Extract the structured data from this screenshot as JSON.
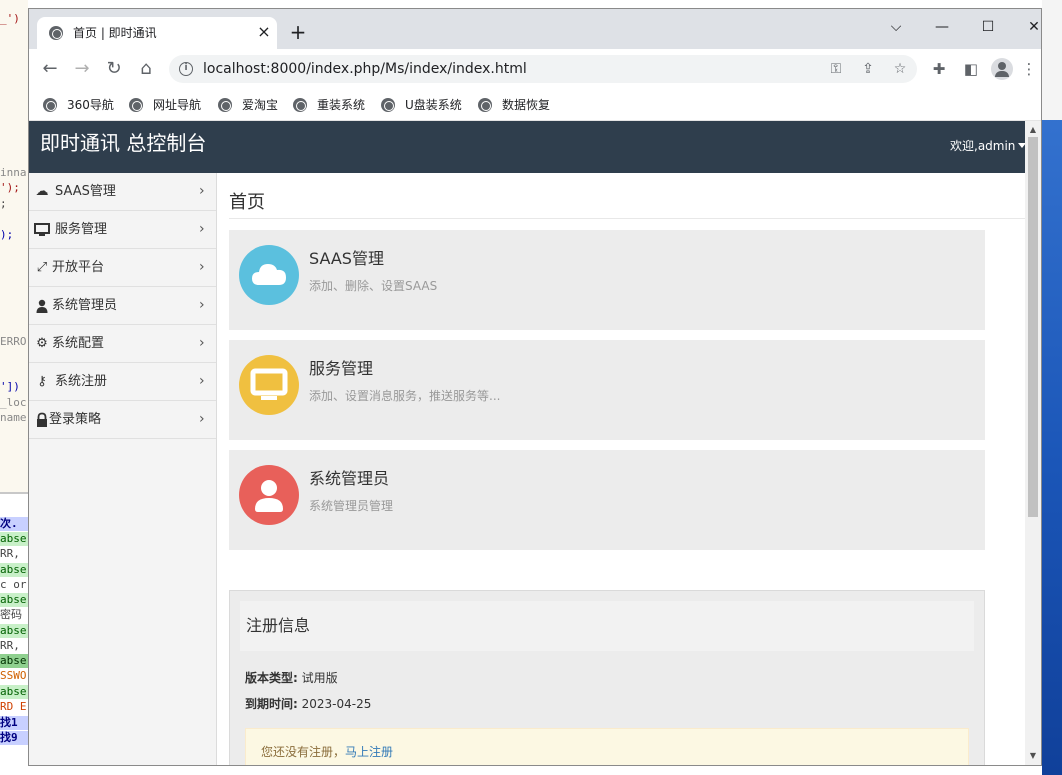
{
  "background": {
    "editor_lines": [
      "_')",
      "inna",
      "');",
      ";",
      ");",
      "ERRO",
      "'])",
      "_loc",
      "name"
    ],
    "log_lines": [
      "次.",
      "abse",
      "RR,",
      "abse",
      "c or",
      "abse",
      "密码",
      "abse",
      "RR,",
      "abse",
      "SSWO",
      "abse",
      "RD E",
      "找1",
      "找9"
    ]
  },
  "browser": {
    "tab_title": "首页 | 即时通讯",
    "tab_close": "×",
    "new_tab": "+",
    "url": "localhost:8000/index.php/Ms/index/index.html",
    "bookmarks": [
      "360导航",
      "网址导航",
      "爱淘宝",
      "重装系统",
      "U盘装系统",
      "数据恢复"
    ]
  },
  "app": {
    "title": "即时通讯 总控制台",
    "welcome": "欢迎,admin"
  },
  "sidebar": {
    "items": [
      {
        "label": "SAAS管理",
        "icon": "cloud-icon"
      },
      {
        "label": "服务管理",
        "icon": "monitor-icon"
      },
      {
        "label": "开放平台",
        "icon": "expand-icon"
      },
      {
        "label": "系统管理员",
        "icon": "user-icon"
      },
      {
        "label": "系统配置",
        "icon": "gear-icon"
      },
      {
        "label": "系统注册",
        "icon": "key-icon"
      },
      {
        "label": "登录策略",
        "icon": "lock-icon"
      }
    ]
  },
  "main": {
    "heading": "首页",
    "cards": [
      {
        "title": "SAAS管理",
        "desc": "添加、删除、设置SAAS",
        "icon": "cloud-icon",
        "color": "#5bc0de"
      },
      {
        "title": "服务管理",
        "desc": "添加、设置消息服务，推送服务等...",
        "icon": "monitor-icon",
        "color": "#f0c040"
      },
      {
        "title": "系统管理员",
        "desc": "系统管理员管理",
        "icon": "user-icon",
        "color": "#e8605a"
      }
    ],
    "registration": {
      "title": "注册信息",
      "version_label": "版本类型:",
      "version_value": "试用版",
      "expiry_label": "到期时间:",
      "expiry_value": "2023-04-25",
      "alert_text": "您还没有注册，",
      "alert_link": "马上注册"
    }
  },
  "colors": {
    "header_bg": "#2f3e4d",
    "sidebar_bg": "#f4f4f4",
    "card_bg": "#ececec",
    "alert_bg": "#fcf8e3",
    "link": "#337ab7"
  }
}
